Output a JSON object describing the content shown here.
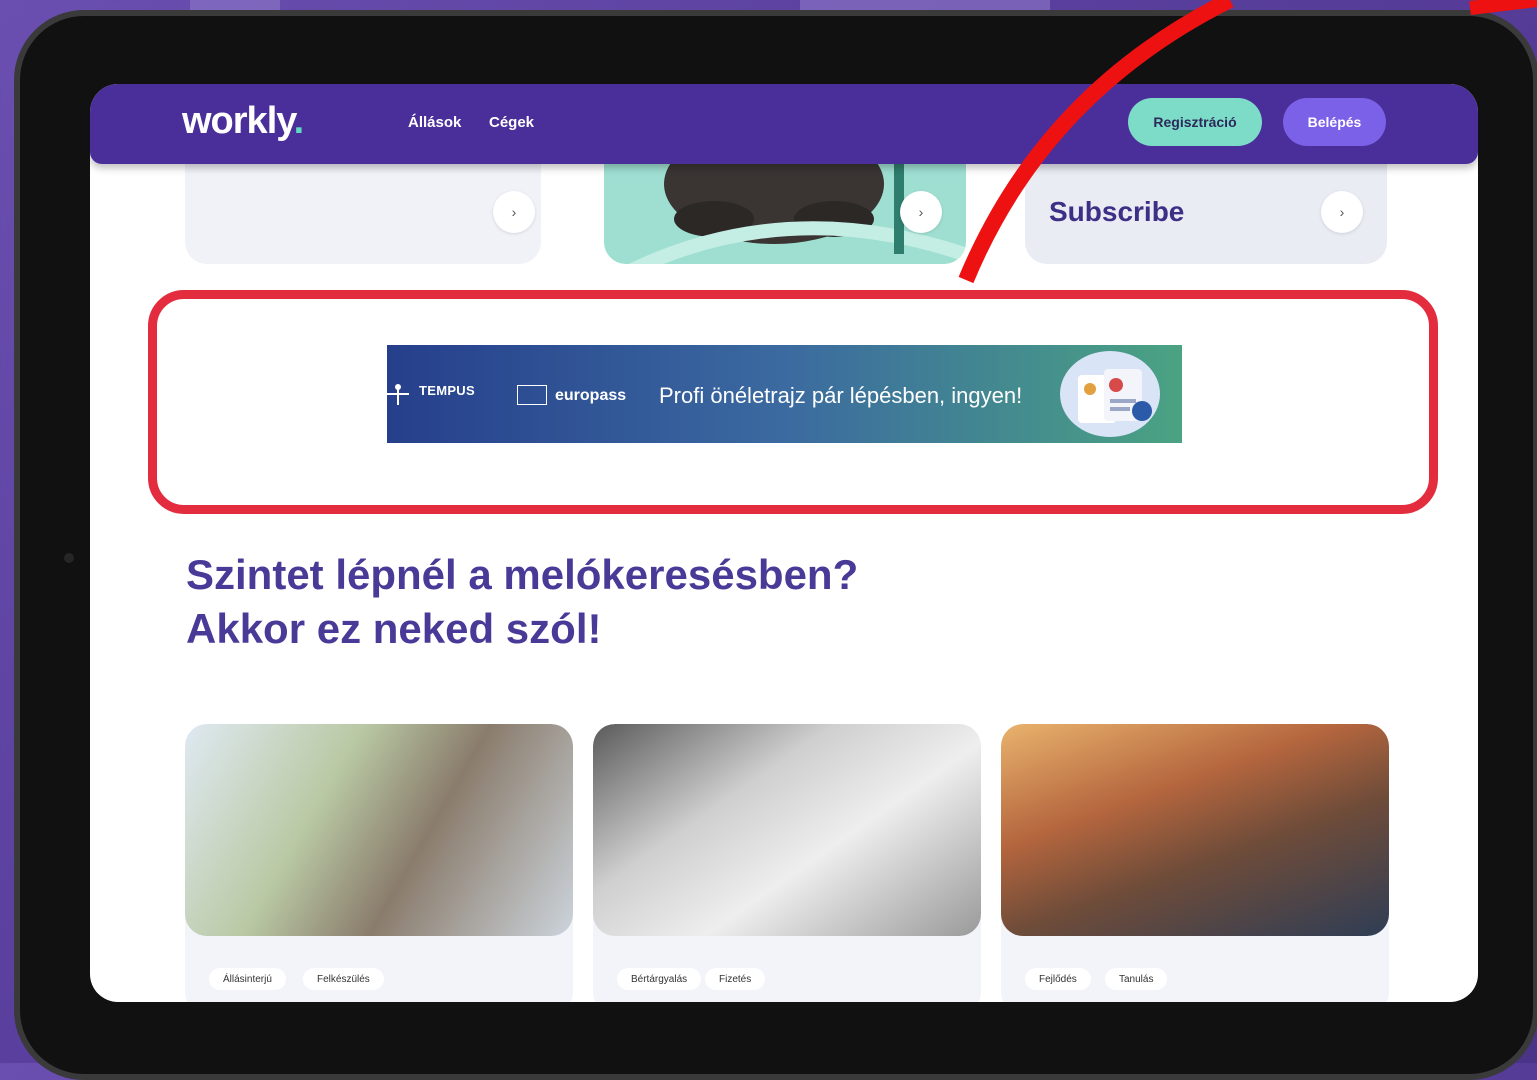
{
  "navbar": {
    "logo": "workly",
    "links": [
      "Állások",
      "Cégek"
    ],
    "register_label": "Regisztráció",
    "login_label": "Belépés"
  },
  "cards": {
    "subscribe_label": "Subscribe",
    "arrow": "›"
  },
  "banner": {
    "tempus": "TEMPUS",
    "europass": "europass",
    "text": "Profi önéletrajz pár lépésben, ingyen!"
  },
  "headline": {
    "line1": "Szintet lépnél a melókeresésben?",
    "line2": "Akkor ez neked szól!"
  },
  "articles": [
    {
      "tags": [
        "Állásinterjú",
        "Felkészülés"
      ]
    },
    {
      "tags": [
        "Bértárgyalás",
        "Fizetés"
      ]
    },
    {
      "tags": [
        "Fejlődés",
        "Tanulás"
      ]
    }
  ],
  "colors": {
    "brand_purple": "#4a2f9a",
    "accent_teal": "#7ddcc7",
    "highlight_red": "#e32c3e"
  }
}
